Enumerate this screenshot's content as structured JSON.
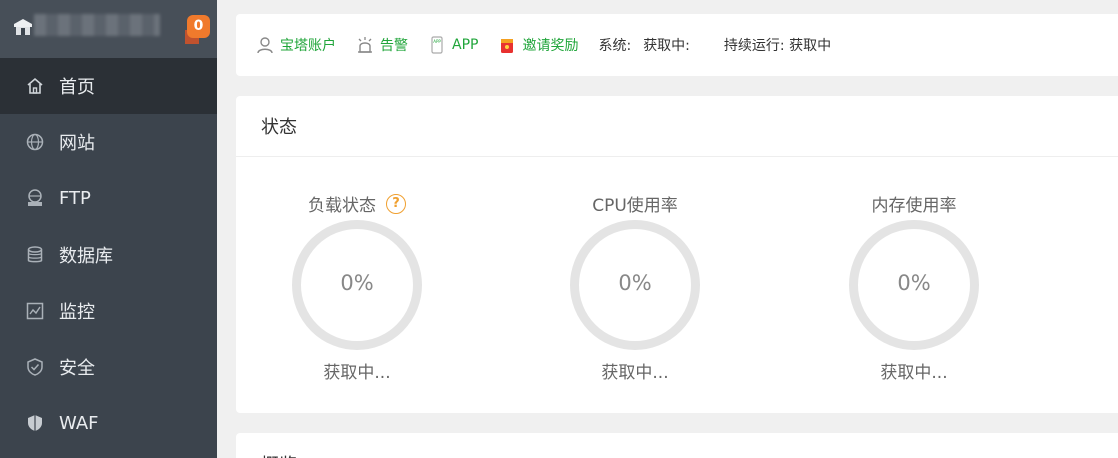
{
  "brand": {
    "badge_count": "0"
  },
  "sidebar": {
    "items": [
      {
        "label": "首页",
        "icon": "home-icon",
        "active": true
      },
      {
        "label": "网站",
        "icon": "globe-icon"
      },
      {
        "label": "FTP",
        "icon": "ftp-icon"
      },
      {
        "label": "数据库",
        "icon": "database-icon"
      },
      {
        "label": "监控",
        "icon": "monitor-icon"
      },
      {
        "label": "安全",
        "icon": "shield-icon"
      },
      {
        "label": "WAF",
        "icon": "waf-shield-icon"
      }
    ]
  },
  "topbar": {
    "account": "宝塔账户",
    "alarm": "告警",
    "app": "APP",
    "invite": "邀请奖励",
    "system_label": "系统:",
    "system_value": "获取中:",
    "uptime_label": "持续运行: 获取中"
  },
  "status": {
    "title": "状态",
    "gauges": [
      {
        "label": "负载状态",
        "value": "0%",
        "status": "获取中..."
      },
      {
        "label": "CPU使用率",
        "value": "0%",
        "status": "获取中..."
      },
      {
        "label": "内存使用率",
        "value": "0%",
        "status": "获取中..."
      }
    ]
  },
  "overview": {
    "title": "概览"
  },
  "colors": {
    "accent_green": "#20a53a",
    "sidebar_bg": "#3c444d",
    "badge_orange": "#f07a2c"
  }
}
